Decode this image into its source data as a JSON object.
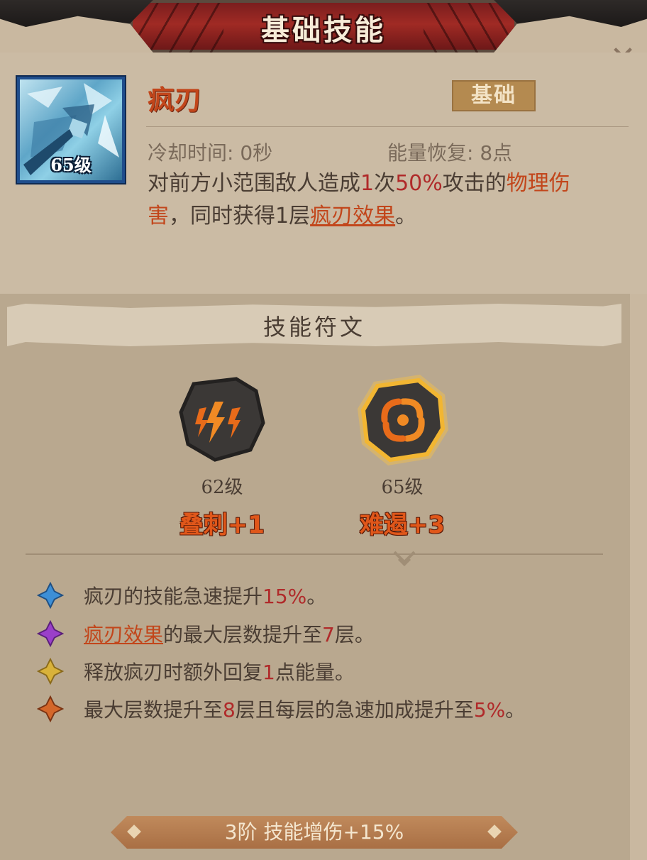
{
  "title": "基础技能",
  "skill": {
    "name": "疯刃",
    "tag": "基础",
    "level": "65级",
    "cooldown": "冷却时间: 0秒",
    "energy": "能量恢复: 8点",
    "desc": {
      "p1": "对前方小范围敌人造成",
      "hits": "1",
      "p2": "次",
      "pct": "50%",
      "p3": "攻击的",
      "dmg_type": "物理伤害",
      "p4": "，同时获得1层",
      "effect": "疯刃效果",
      "p5": "。"
    }
  },
  "runes": {
    "header": "技能符文",
    "items": [
      {
        "level": "62级",
        "name": "叠刺+1",
        "icon": "lightning-icon"
      },
      {
        "level": "65级",
        "name": "难遏+3",
        "icon": "swirl-icon",
        "highlighted": true
      }
    ]
  },
  "effects": [
    {
      "gem": "blue",
      "parts": [
        "疯刃的技能急速提升",
        "15%",
        "。"
      ]
    },
    {
      "gem": "purple",
      "link": "疯刃效果",
      "parts": [
        "的最大层数提升至",
        "7",
        "层。"
      ]
    },
    {
      "gem": "yellow",
      "parts": [
        "释放疯刃时额外回复",
        "1",
        "点能量。"
      ]
    },
    {
      "gem": "orange",
      "parts": [
        "最大层数提升至",
        "8",
        "层且每层的急速加成提升至",
        "5%",
        "。"
      ]
    }
  ],
  "bottom_bar": "3阶 技能增伤+15%",
  "colors": {
    "gem_blue": "#3d8fd6",
    "gem_purple": "#9a3fc9",
    "gem_yellow": "#d9b23a",
    "gem_orange": "#d4672a"
  }
}
